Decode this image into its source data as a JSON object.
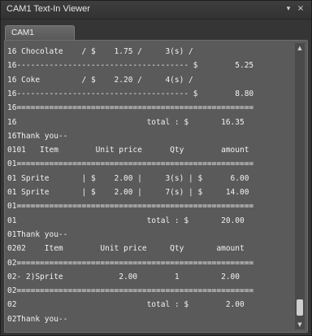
{
  "window": {
    "title": "CAM1 Text-In Viewer",
    "menu_glyph": "▾",
    "close_glyph": "×"
  },
  "tabs": [
    {
      "label": "CAM1",
      "active": true
    }
  ],
  "scrollbar": {
    "up_glyph": "▲",
    "down_glyph": "▼",
    "position": "bottom"
  },
  "receipt_lines": [
    "16 Chocolate    / $    1.75 /     3(s) /",
    "16------------------------------------- $        5.25",
    "16 Coke         / $    2.20 /     4(s) /",
    "16------------------------------------- $        8.80",
    "16===================================================",
    "16                            total : $       16.35",
    "16Thank you--",
    "0101   Item        Unit price      Qty        amount",
    "01===================================================",
    "01 Sprite       | $    2.00 |     3(s) | $      6.00",
    "01 Sprite       | $    2.00 |     7(s) | $     14.00",
    "01===================================================",
    "01                            total : $       20.00",
    "01Thank you--",
    "0202    Item        Unit price     Qty       amount",
    "02===================================================",
    "02- 2)Sprite            2.00        1         2.00",
    "02===================================================",
    "02                            total : $        2.00",
    "02Thank you--"
  ]
}
